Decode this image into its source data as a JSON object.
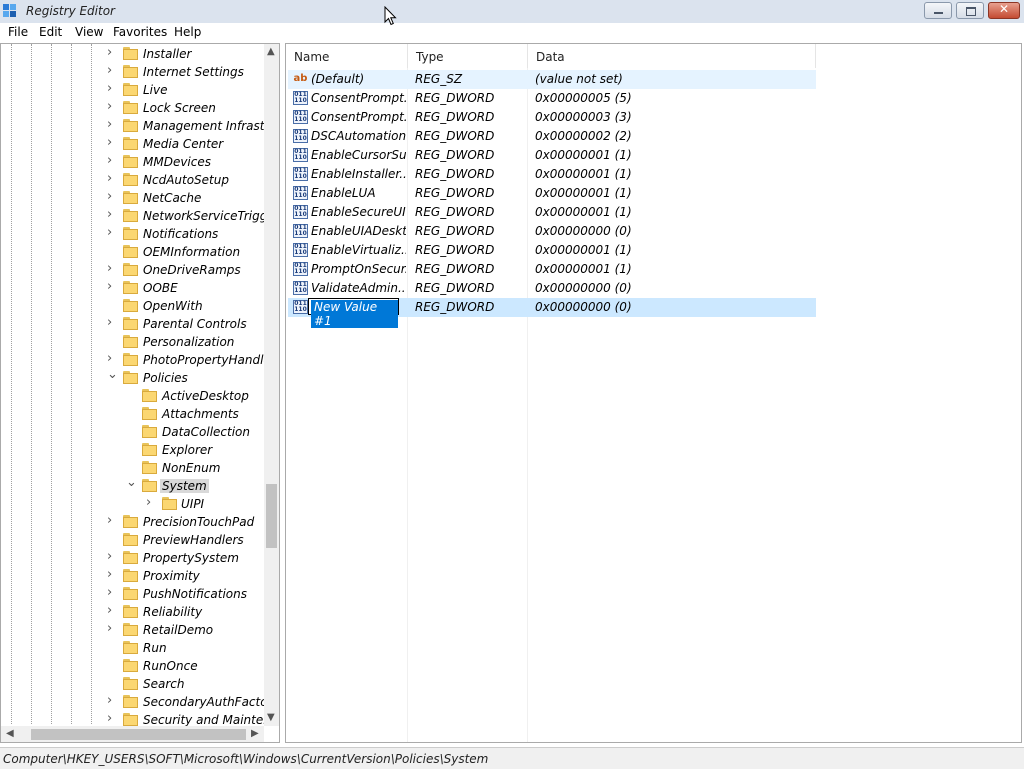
{
  "window": {
    "title": "Registry Editor"
  },
  "menu": [
    "File",
    "Edit",
    "View",
    "Favorites",
    "Help"
  ],
  "tree": {
    "items": [
      {
        "label": "Installer",
        "level": 0,
        "expander": "collapsed"
      },
      {
        "label": "Internet Settings",
        "level": 0,
        "expander": "collapsed"
      },
      {
        "label": "Live",
        "level": 0,
        "expander": "collapsed"
      },
      {
        "label": "Lock Screen",
        "level": 0,
        "expander": "collapsed"
      },
      {
        "label": "Management Infrastruc",
        "level": 0,
        "expander": "collapsed"
      },
      {
        "label": "Media Center",
        "level": 0,
        "expander": "collapsed"
      },
      {
        "label": "MMDevices",
        "level": 0,
        "expander": "collapsed"
      },
      {
        "label": "NcdAutoSetup",
        "level": 0,
        "expander": "collapsed"
      },
      {
        "label": "NetCache",
        "level": 0,
        "expander": "collapsed"
      },
      {
        "label": "NetworkServiceTriggers",
        "level": 0,
        "expander": "collapsed"
      },
      {
        "label": "Notifications",
        "level": 0,
        "expander": "collapsed"
      },
      {
        "label": "OEMInformation",
        "level": 0,
        "expander": "none"
      },
      {
        "label": "OneDriveRamps",
        "level": 0,
        "expander": "collapsed"
      },
      {
        "label": "OOBE",
        "level": 0,
        "expander": "collapsed"
      },
      {
        "label": "OpenWith",
        "level": 0,
        "expander": "none"
      },
      {
        "label": "Parental Controls",
        "level": 0,
        "expander": "collapsed"
      },
      {
        "label": "Personalization",
        "level": 0,
        "expander": "none"
      },
      {
        "label": "PhotoPropertyHandler",
        "level": 0,
        "expander": "collapsed"
      },
      {
        "label": "Policies",
        "level": 0,
        "expander": "expanded"
      },
      {
        "label": "ActiveDesktop",
        "level": 1,
        "expander": "none"
      },
      {
        "label": "Attachments",
        "level": 1,
        "expander": "none"
      },
      {
        "label": "DataCollection",
        "level": 1,
        "expander": "none"
      },
      {
        "label": "Explorer",
        "level": 1,
        "expander": "none"
      },
      {
        "label": "NonEnum",
        "level": 1,
        "expander": "none"
      },
      {
        "label": "System",
        "level": 1,
        "expander": "expanded",
        "selected": true
      },
      {
        "label": "UIPI",
        "level": 2,
        "expander": "collapsed"
      },
      {
        "label": "PrecisionTouchPad",
        "level": 0,
        "expander": "collapsed"
      },
      {
        "label": "PreviewHandlers",
        "level": 0,
        "expander": "none"
      },
      {
        "label": "PropertySystem",
        "level": 0,
        "expander": "collapsed"
      },
      {
        "label": "Proximity",
        "level": 0,
        "expander": "collapsed"
      },
      {
        "label": "PushNotifications",
        "level": 0,
        "expander": "collapsed"
      },
      {
        "label": "Reliability",
        "level": 0,
        "expander": "collapsed"
      },
      {
        "label": "RetailDemo",
        "level": 0,
        "expander": "collapsed"
      },
      {
        "label": "Run",
        "level": 0,
        "expander": "none"
      },
      {
        "label": "RunOnce",
        "level": 0,
        "expander": "none"
      },
      {
        "label": "Search",
        "level": 0,
        "expander": "none"
      },
      {
        "label": "SecondaryAuthFactor",
        "level": 0,
        "expander": "collapsed"
      },
      {
        "label": "Security and Maintenai",
        "level": 0,
        "expander": "collapsed"
      }
    ]
  },
  "list": {
    "columns": [
      "Name",
      "Type",
      "Data"
    ],
    "rows": [
      {
        "icon": "string-value-icon",
        "name": "(Default)",
        "type": "REG_SZ",
        "data": "(value not set)",
        "state": "hover"
      },
      {
        "icon": "binary-value-icon",
        "name": "ConsentPrompt...",
        "type": "REG_DWORD",
        "data": "0x00000005 (5)"
      },
      {
        "icon": "binary-value-icon",
        "name": "ConsentPrompt...",
        "type": "REG_DWORD",
        "data": "0x00000003 (3)"
      },
      {
        "icon": "binary-value-icon",
        "name": "DSCAutomation...",
        "type": "REG_DWORD",
        "data": "0x00000002 (2)"
      },
      {
        "icon": "binary-value-icon",
        "name": "EnableCursorSu...",
        "type": "REG_DWORD",
        "data": "0x00000001 (1)"
      },
      {
        "icon": "binary-value-icon",
        "name": "EnableInstaller...",
        "type": "REG_DWORD",
        "data": "0x00000001 (1)"
      },
      {
        "icon": "binary-value-icon",
        "name": "EnableLUA",
        "type": "REG_DWORD",
        "data": "0x00000001 (1)"
      },
      {
        "icon": "binary-value-icon",
        "name": "EnableSecureUI...",
        "type": "REG_DWORD",
        "data": "0x00000001 (1)"
      },
      {
        "icon": "binary-value-icon",
        "name": "EnableUIADeskt...",
        "type": "REG_DWORD",
        "data": "0x00000000 (0)"
      },
      {
        "icon": "binary-value-icon",
        "name": "EnableVirtualiz...",
        "type": "REG_DWORD",
        "data": "0x00000001 (1)"
      },
      {
        "icon": "binary-value-icon",
        "name": "PromptOnSecur...",
        "type": "REG_DWORD",
        "data": "0x00000001 (1)"
      },
      {
        "icon": "binary-value-icon",
        "name": "ValidateAdmin...",
        "type": "REG_DWORD",
        "data": "0x00000000 (0)"
      },
      {
        "icon": "binary-value-icon",
        "name": "New Value #1",
        "type": "REG_DWORD",
        "data": "0x00000000 (0)",
        "state": "renaming"
      }
    ]
  },
  "status": {
    "path": "Computer\\HKEY_USERS\\SOFT\\Microsoft\\Windows\\CurrentVersion\\Policies\\System"
  }
}
